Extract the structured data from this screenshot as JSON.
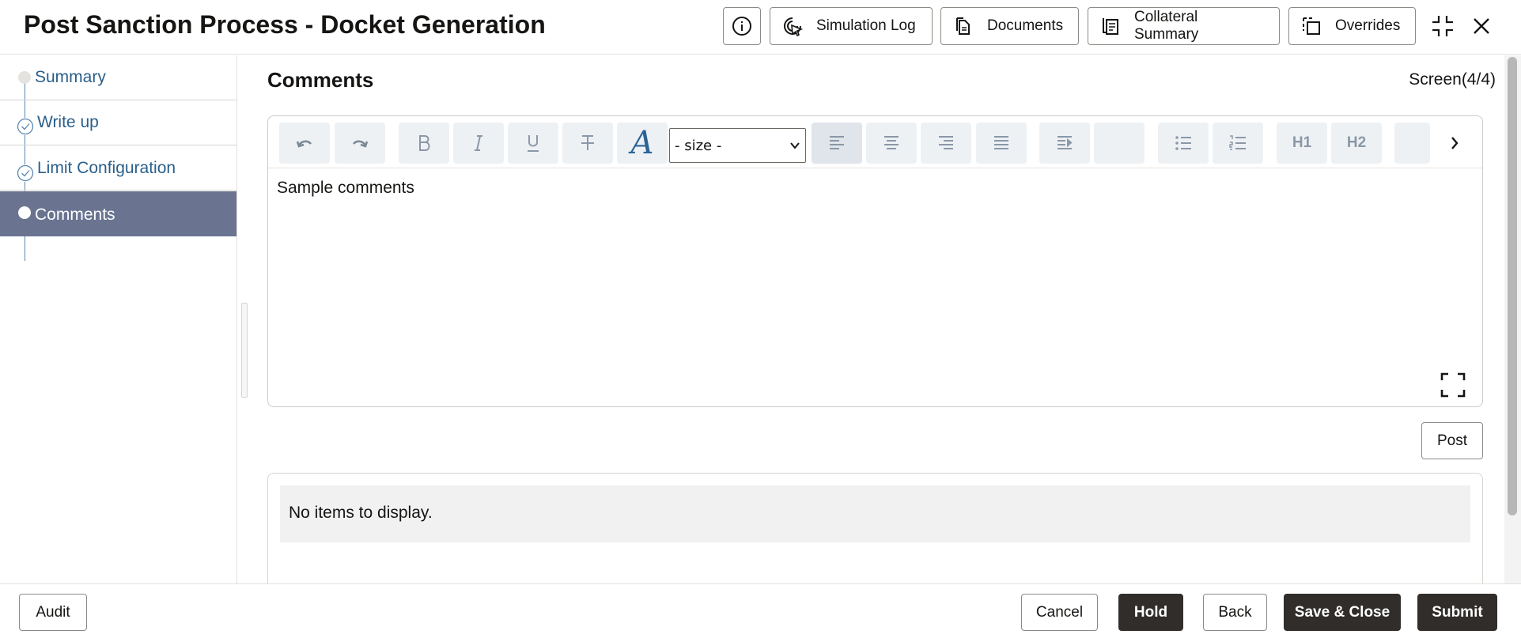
{
  "header": {
    "title": "Post Sanction Process - Docket Generation",
    "buttons": {
      "simulation_log": "Simulation Log",
      "documents": "Documents",
      "collateral_summary": "Collateral Summary",
      "overrides": "Overrides"
    },
    "icons": [
      "info-icon",
      "simulation-cursor-icon",
      "documents-icon",
      "collateral-summary-icon",
      "overrides-icon",
      "collapse-icon",
      "close-icon"
    ]
  },
  "sidebar": {
    "items": [
      {
        "label": "Summary",
        "state": "pending"
      },
      {
        "label": "Write up",
        "state": "completed"
      },
      {
        "label": "Limit Configuration",
        "state": "completed"
      },
      {
        "label": "Comments",
        "state": "active"
      }
    ]
  },
  "main": {
    "section_title": "Comments",
    "screen_indicator": "Screen(4/4)",
    "editor": {
      "size_select_value": "- size -",
      "content": "Sample comments",
      "toolbar_icons": [
        "undo-icon",
        "redo-icon",
        "bold-icon",
        "italic-icon",
        "underline-icon",
        "strikethrough-icon",
        "font-color-icon",
        "align-left-icon",
        "align-center-icon",
        "align-right-icon",
        "justify-icon",
        "indent-icon",
        "bullet-list-icon",
        "numbered-list-icon",
        "heading1-icon",
        "heading2-icon",
        "more-icon"
      ],
      "heading1_label": "H1",
      "heading2_label": "H2",
      "font_color_glyph": "A"
    },
    "post_label": "Post",
    "empty_message": "No items to display."
  },
  "footer": {
    "audit": "Audit",
    "cancel": "Cancel",
    "hold": "Hold",
    "back": "Back",
    "save_close": "Save & Close",
    "submit": "Submit"
  },
  "colors": {
    "accent_nav": "#6a7491",
    "link": "#2a5f8a",
    "dark_button": "#312d2a",
    "font_color_icon": "#2a6496"
  }
}
